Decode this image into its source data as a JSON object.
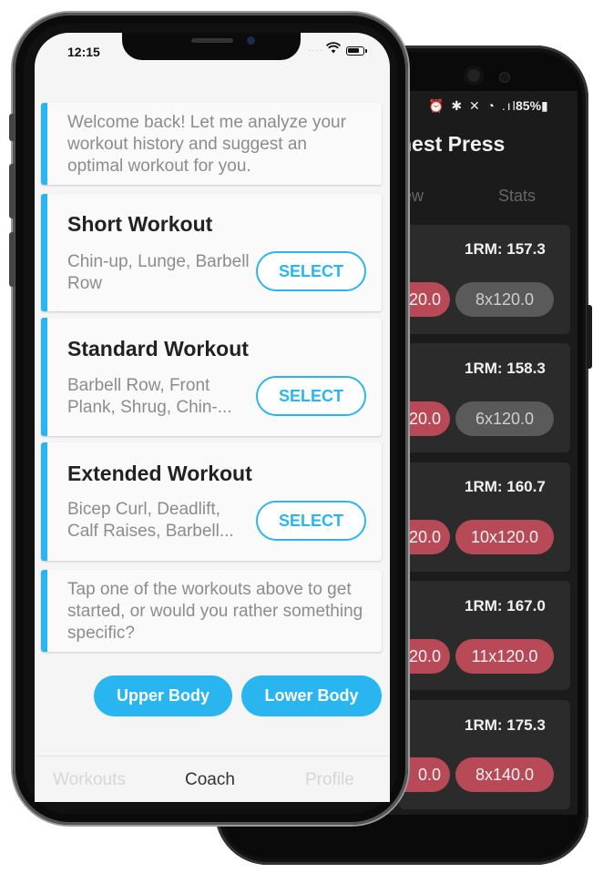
{
  "back_app": {
    "status": {
      "icons": "⏰ ✱ ✕ ◔ .ıl",
      "battery": "85%▮"
    },
    "title": "hest Press",
    "tabs": [
      "iew",
      "Stats"
    ],
    "cards": [
      {
        "rm": "1RM: 157.3",
        "partial": "20.0",
        "set": "8x120.0",
        "set_style": "gray"
      },
      {
        "rm": "1RM: 158.3",
        "partial": "20.0",
        "set": "6x120.0",
        "set_style": "gray"
      },
      {
        "rm": "1RM: 160.7",
        "partial": "20.0",
        "set": "10x120.0",
        "set_style": "red"
      },
      {
        "rm": "1RM: 167.0",
        "partial": "20.0",
        "set": "11x120.0",
        "set_style": "red"
      },
      {
        "rm": "1RM: 175.3",
        "partial": "0.0",
        "set": "8x140.0",
        "set_style": "red"
      }
    ]
  },
  "status_bar": {
    "time": "12:15",
    "signal": "····"
  },
  "chat": {
    "welcome": "Welcome back! Let me analyze your workout history and suggest an optimal workout for you.",
    "workouts": [
      {
        "name": "Short Workout",
        "exercises": "Chin-up, Lunge, Barbell Row",
        "button": "SELECT"
      },
      {
        "name": "Standard Workout",
        "exercises": "Barbell Row, Front Plank, Shrug, Chin-...",
        "button": "SELECT"
      },
      {
        "name": "Extended Workout",
        "exercises": "Bicep Curl, Deadlift, Calf Raises, Barbell...",
        "button": "SELECT"
      }
    ],
    "prompt": "Tap one of the workouts above to get started, or would you rather something specific?",
    "quick_replies": [
      "Upper Body",
      "Lower Body"
    ]
  },
  "tabbar": {
    "items": [
      "Workouts",
      "Coach",
      "Profile"
    ],
    "active": "Coach"
  },
  "colors": {
    "accent": "#29b6f0",
    "set_red": "#b84a58",
    "set_gray": "#5a5a5a"
  }
}
